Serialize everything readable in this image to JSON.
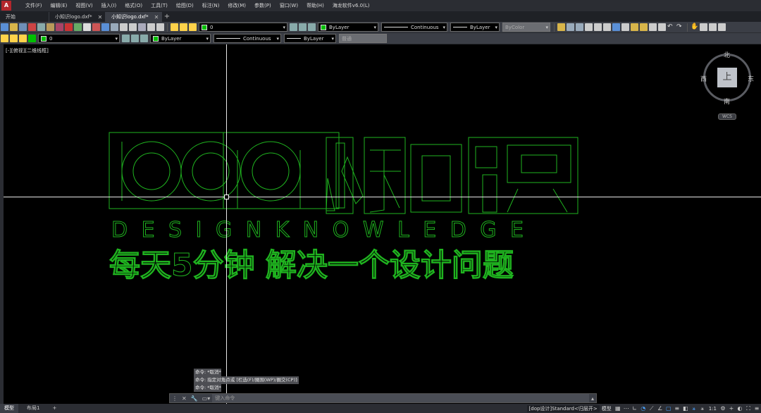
{
  "app": {
    "icon": "app-logo-icon",
    "menu": [
      "文件(F)",
      "编辑(E)",
      "视图(V)",
      "插入(I)",
      "格式(O)",
      "工具(T)",
      "绘图(D)",
      "标注(N)",
      "修改(M)",
      "参数(P)",
      "窗口(W)",
      "帮助(H)",
      "海龙软件v6.0(L)"
    ]
  },
  "tabs": [
    {
      "label": "开始",
      "active": false
    },
    {
      "label": "小知识logo.dxf*",
      "active": false
    },
    {
      "label": "小知识logo.dxf*",
      "active": true
    }
  ],
  "tab_add": "+",
  "toolbar1": {
    "layer_value": "0",
    "color_value": "ByLayer",
    "linetype_value": "Continuous",
    "lineweight_value": "ByLayer",
    "plotstyle_value": "ByColor"
  },
  "toolbar2": {
    "layer_value": "0",
    "color_value": "ByLayer",
    "linetype_value": "Continuous",
    "lineweight_value": "ByLayer",
    "plotstyle_value": "普通"
  },
  "canvas": {
    "viewport_label": "[-][俯视][二维线框]",
    "logo": {
      "main_text": "dop小知识",
      "sub_text": "DESIGNKNOWLEDGE",
      "slogan": "每天5分钟 解决一个设计问题",
      "stroke_color": "#1fb31f"
    }
  },
  "viewcube": {
    "face": "上",
    "north": "北",
    "south": "南",
    "east": "东",
    "west": "西",
    "wcs": "WCS"
  },
  "command": {
    "history": [
      "命令: *取消*",
      "命令: 指定对角点或 [栏选(F)/圈围(WP)/圈交(CP)]:",
      "命令: *取消*"
    ],
    "placeholder": "键入命令"
  },
  "status": {
    "layout_tabs": [
      {
        "label": "模型",
        "active": true
      },
      {
        "label": "布局1",
        "active": false
      }
    ],
    "layout_add": "+",
    "style_text": "[dop设计]Standard<归层开>",
    "model_label": "模型",
    "scale_label": "1:1"
  }
}
